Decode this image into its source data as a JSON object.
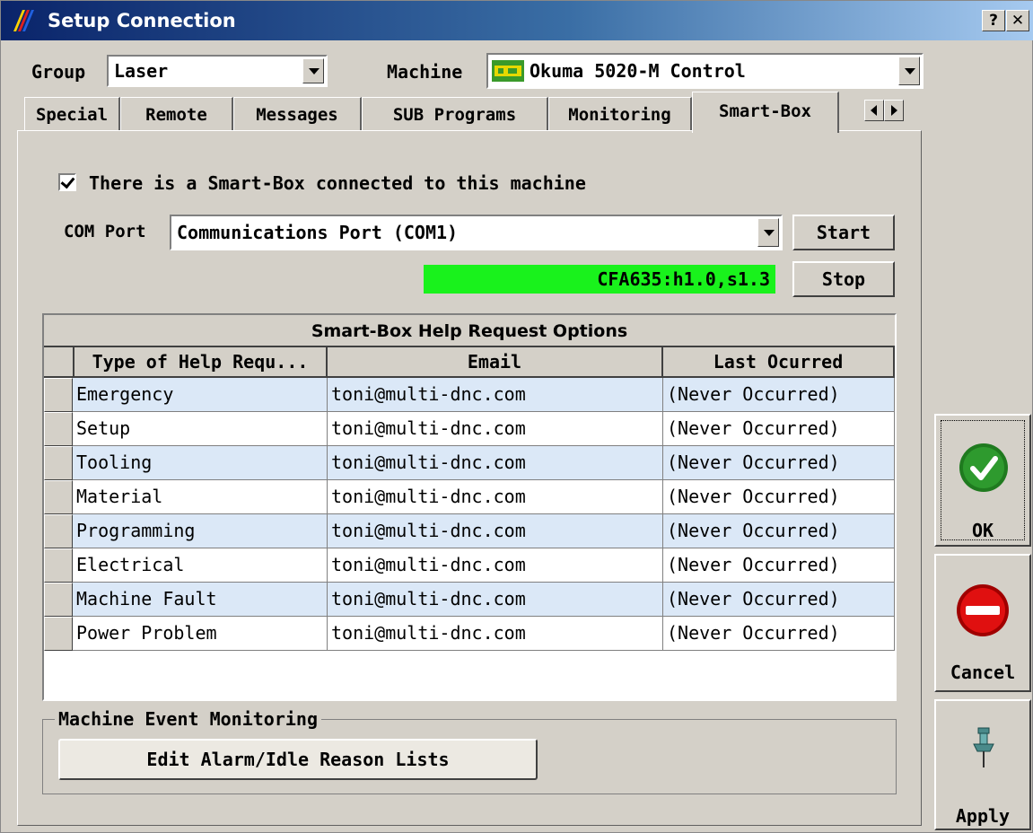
{
  "window": {
    "title": "Setup Connection",
    "help_glyph": "?",
    "close_glyph": "✕"
  },
  "top": {
    "group_label": "Group",
    "group_value": "Laser",
    "machine_label": "Machine",
    "machine_value": "Okuma 5020-M Control"
  },
  "tabs": [
    "Special",
    "Remote",
    "Messages",
    "SUB Programs",
    "Monitoring",
    "Smart-Box"
  ],
  "active_tab": "Smart-Box",
  "smartbox": {
    "checkbox_label": "There is a Smart-Box connected to this machine",
    "checkbox_checked": true,
    "com_port_label": "COM Port",
    "com_port_value": "Communications Port (COM1)",
    "start_label": "Start",
    "stop_label": "Stop",
    "status_text": "CFA635:h1.0,s1.3",
    "status_color": "#19f21c"
  },
  "grid": {
    "caption": "Smart-Box Help Request Options",
    "columns": [
      "Type of Help Requ...",
      "Email",
      "Last Ocurred"
    ],
    "rows": [
      [
        "Emergency",
        "toni@multi-dnc.com",
        "(Never Occurred)"
      ],
      [
        "Setup",
        "toni@multi-dnc.com",
        "(Never Occurred)"
      ],
      [
        "Tooling",
        "toni@multi-dnc.com",
        "(Never Occurred)"
      ],
      [
        "Material",
        "toni@multi-dnc.com",
        "(Never Occurred)"
      ],
      [
        "Programming",
        "toni@multi-dnc.com",
        "(Never Occurred)"
      ],
      [
        "Electrical",
        "toni@multi-dnc.com",
        "(Never Occurred)"
      ],
      [
        "Machine Fault",
        "toni@multi-dnc.com",
        "(Never Occurred)"
      ],
      [
        "Power Problem",
        "toni@multi-dnc.com",
        "(Never Occurred)"
      ]
    ],
    "alt_row_color": "#dbe8f7"
  },
  "monitoring": {
    "legend": "Machine Event Monitoring",
    "button_label": "Edit Alarm/Idle Reason Lists"
  },
  "actions": {
    "ok_label": "OK",
    "cancel_label": "Cancel",
    "apply_label": "Apply"
  },
  "icons": {
    "title": "pencil-stripes-icon",
    "machine": "machine-icon",
    "ok": "green-check-icon",
    "cancel": "red-stop-icon",
    "apply": "pushpin-icon"
  }
}
